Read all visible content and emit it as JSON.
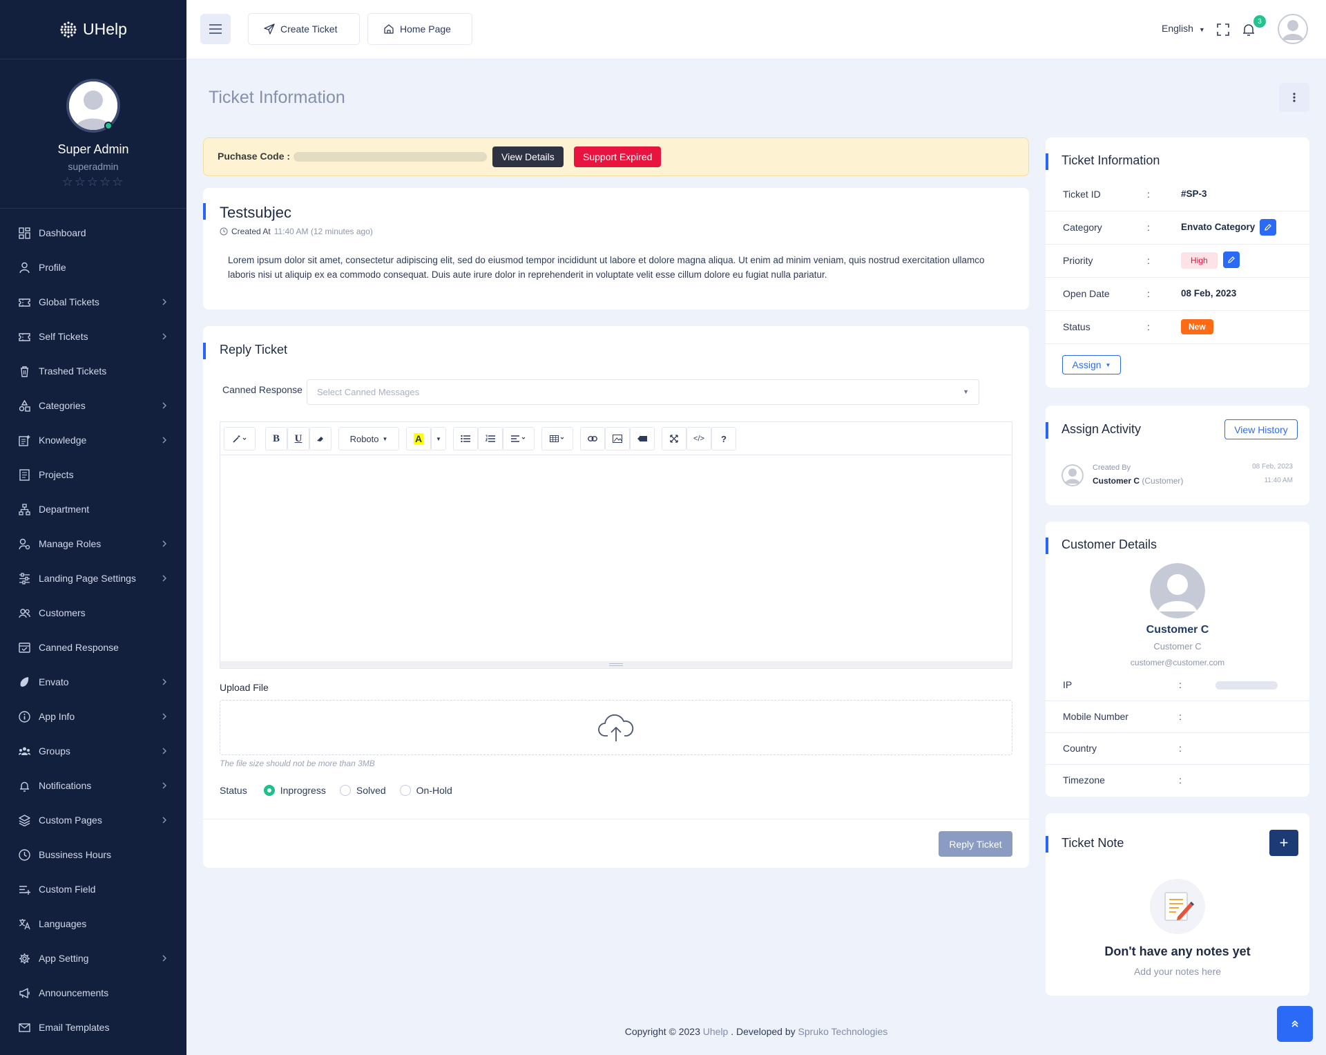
{
  "app": {
    "name": "UHelp"
  },
  "sidebar": {
    "user": {
      "name": "Super Admin",
      "username": "superadmin",
      "rating": "☆☆☆☆☆"
    },
    "items": [
      {
        "label": "Dashboard",
        "icon": "dashboard-icon",
        "chevron": false
      },
      {
        "label": "Profile",
        "icon": "user-icon",
        "chevron": false
      },
      {
        "label": "Global Tickets",
        "icon": "ticket-icon",
        "chevron": true
      },
      {
        "label": "Self Tickets",
        "icon": "ticket-icon",
        "chevron": true
      },
      {
        "label": "Trashed Tickets",
        "icon": "trash-icon",
        "chevron": false
      },
      {
        "label": "Categories",
        "icon": "categories-icon",
        "chevron": true
      },
      {
        "label": "Knowledge",
        "icon": "knowledge-icon",
        "chevron": true
      },
      {
        "label": "Projects",
        "icon": "projects-icon",
        "chevron": false
      },
      {
        "label": "Department",
        "icon": "department-icon",
        "chevron": false
      },
      {
        "label": "Manage Roles",
        "icon": "roles-icon",
        "chevron": true
      },
      {
        "label": "Landing Page Settings",
        "icon": "sliders-icon",
        "chevron": true
      },
      {
        "label": "Customers",
        "icon": "customers-icon",
        "chevron": false
      },
      {
        "label": "Canned Response",
        "icon": "canned-icon",
        "chevron": false
      },
      {
        "label": "Envato",
        "icon": "envato-icon",
        "chevron": true
      },
      {
        "label": "App Info",
        "icon": "info-icon",
        "chevron": true
      },
      {
        "label": "Groups",
        "icon": "groups-icon",
        "chevron": true
      },
      {
        "label": "Notifications",
        "icon": "bell-icon",
        "chevron": true
      },
      {
        "label": "Custom Pages",
        "icon": "layers-icon",
        "chevron": true
      },
      {
        "label": "Bussiness Hours",
        "icon": "clock-icon",
        "chevron": false
      },
      {
        "label": "Custom Field",
        "icon": "field-icon",
        "chevron": false
      },
      {
        "label": "Languages",
        "icon": "languages-icon",
        "chevron": false
      },
      {
        "label": "App Setting",
        "icon": "gear-icon",
        "chevron": true
      },
      {
        "label": "Announcements",
        "icon": "megaphone-icon",
        "chevron": false
      },
      {
        "label": "Email Templates",
        "icon": "mail-icon",
        "chevron": false
      }
    ]
  },
  "header": {
    "create_ticket": "Create Ticket",
    "home_page": "Home Page",
    "language": "English",
    "notification_count": "3"
  },
  "page": {
    "title": "Ticket Information"
  },
  "purchase": {
    "label": "Puchase Code :",
    "view_details": "View Details",
    "support_status": "Support Expired"
  },
  "ticket": {
    "subject": "Testsubjec",
    "created_label": "Created At",
    "created_value": "11:40 AM (12 minutes ago)",
    "description": "Lorem ipsum dolor sit amet, consectetur adipiscing elit, sed do eiusmod tempor incididunt ut labore et dolore magna aliqua. Ut enim ad minim veniam, quis nostrud exercitation ullamco laboris nisi ut aliquip ex ea commodo consequat. Duis aute irure dolor in reprehenderit in voluptate velit esse cillum dolore eu fugiat nulla pariatur."
  },
  "reply": {
    "title": "Reply Ticket",
    "canned_label": "Canned Response",
    "canned_placeholder": "Select Canned Messages",
    "font_name": "Roboto",
    "upload_label": "Upload File",
    "upload_hint": "The file size should not be more than 3MB",
    "status_label": "Status",
    "status_options": [
      "Inprogress",
      "Solved",
      "On-Hold"
    ],
    "status_selected": "Inprogress",
    "submit": "Reply Ticket"
  },
  "info": {
    "title": "Ticket Information",
    "rows": [
      {
        "key": "Ticket ID",
        "value": "#SP-3"
      },
      {
        "key": "Category",
        "value": "Envato Category"
      },
      {
        "key": "Priority",
        "value": "High"
      },
      {
        "key": "Open Date",
        "value": "08 Feb, 2023"
      },
      {
        "key": "Status",
        "value": "New"
      }
    ],
    "colon": ":",
    "assign": "Assign"
  },
  "activity": {
    "title": "Assign Activity",
    "view_history": "View History",
    "created_by_label": "Created By",
    "user": "Customer C",
    "role": "(Customer)",
    "date": "08 Feb, 2023",
    "time": "11:40 AM"
  },
  "customer": {
    "title": "Customer Details",
    "name": "Customer C",
    "sub": "Customer C",
    "email": "customer@customer.com",
    "rows": [
      {
        "key": "IP"
      },
      {
        "key": "Mobile Number"
      },
      {
        "key": "Country"
      },
      {
        "key": "Timezone"
      }
    ]
  },
  "note": {
    "title": "Ticket Note",
    "plus": "+",
    "empty_title": "Don't have any notes yet",
    "empty_sub": "Add your notes here"
  },
  "footer": {
    "prefix": "Copyright © 2023",
    "brand": "Uhelp",
    "middle": ". Developed by",
    "company": "Spruko Technologies"
  },
  "colors": {
    "accent": "#2b6af6",
    "sidebar": "#121f3d",
    "danger": "#e8133e",
    "success": "#22c38e",
    "warning": "#ff6a14"
  }
}
